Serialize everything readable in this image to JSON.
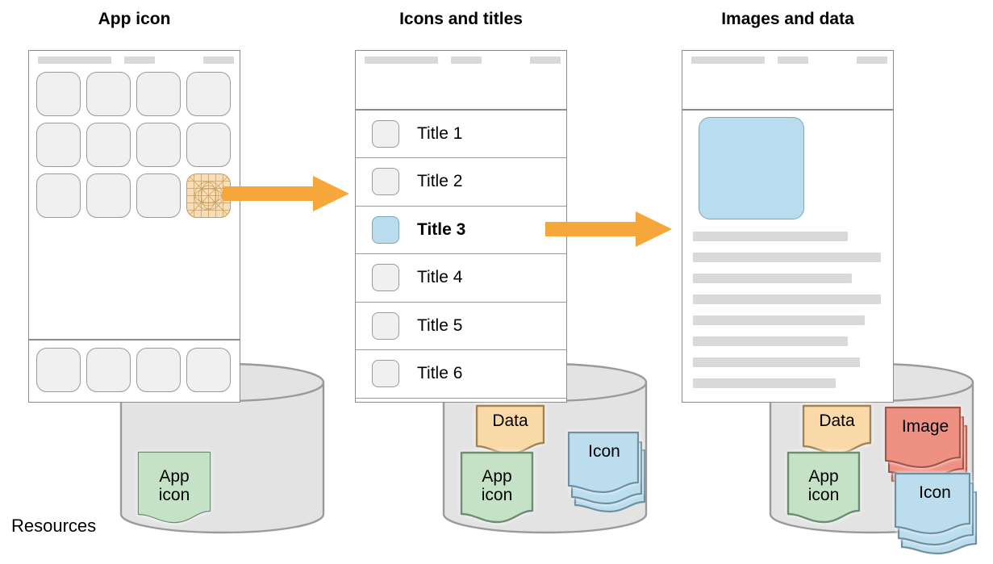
{
  "columns": [
    {
      "title": "App icon"
    },
    {
      "title": "Icons and titles"
    },
    {
      "title": "Images and data"
    }
  ],
  "resources_label": "Resources",
  "colors": {
    "arrow": "#F5A73B",
    "frame_stroke": "#8C8C8C",
    "icon_fill": "#F0F0F0",
    "icon_stroke": "#9A9A9A",
    "highlight_icon_fill": "#F6DFB8",
    "highlight_icon_stroke": "#C79A5E",
    "selected_blue_fill": "#B9DDEE",
    "selected_blue_stroke": "#7FA7B7",
    "placeholder_grey": "#D9D9D9",
    "cylinder_fill": "#E3E3E3",
    "cylinder_stroke": "#9A9A9A",
    "card_green_fill": "#C5E2C6",
    "card_green_stroke": "#6E8C70",
    "card_orange_fill": "#FAD9A8",
    "card_orange_stroke": "#A08456",
    "card_blue_fill": "#BCDDEE",
    "card_blue_stroke": "#6F90A0",
    "card_red_fill": "#EE9183",
    "card_red_stroke": "#A1564B"
  },
  "springboard": {
    "statusbar_segments": [
      "segment-wide",
      "segment-mid",
      "segment-small"
    ],
    "rows": 3,
    "cols": 4,
    "highlighted_cell_index": 11,
    "dock_count": 4
  },
  "list_panel": {
    "statusbar_segments": [
      "segment-wide",
      "segment-mid",
      "segment-small"
    ],
    "rows": [
      {
        "label": "Title 1",
        "selected": false
      },
      {
        "label": "Title 2",
        "selected": false
      },
      {
        "label": "Title 3",
        "selected": true
      },
      {
        "label": "Title 4",
        "selected": false
      },
      {
        "label": "Title 5",
        "selected": false
      },
      {
        "label": "Title 6",
        "selected": false
      }
    ]
  },
  "detail_panel": {
    "statusbar_segments": [
      "segment-wide",
      "segment-mid",
      "segment-small"
    ],
    "hero_image_label": "image-placeholder",
    "text_line_widths": [
      192,
      233,
      197,
      233,
      213,
      192,
      207,
      177
    ]
  },
  "cylinders": [
    {
      "name": "resources-app-icon",
      "cards": [
        {
          "label": "App\nicon",
          "kind": "green",
          "stack": 1
        }
      ]
    },
    {
      "name": "resources-icons-titles",
      "cards": [
        {
          "label": "Data",
          "kind": "orange",
          "stack": 1
        },
        {
          "label": "App\nicon",
          "kind": "green",
          "stack": 1
        },
        {
          "label": "Icon",
          "kind": "blue",
          "stack": 3
        }
      ]
    },
    {
      "name": "resources-images-data",
      "cards": [
        {
          "label": "Data",
          "kind": "orange",
          "stack": 1
        },
        {
          "label": "App\nicon",
          "kind": "green",
          "stack": 1
        },
        {
          "label": "Image",
          "kind": "red",
          "stack": 3
        },
        {
          "label": "Icon",
          "kind": "blue",
          "stack": 3
        }
      ]
    }
  ],
  "arrows": [
    {
      "name": "arrow-app-icon-to-list"
    },
    {
      "name": "arrow-list-to-detail"
    }
  ]
}
